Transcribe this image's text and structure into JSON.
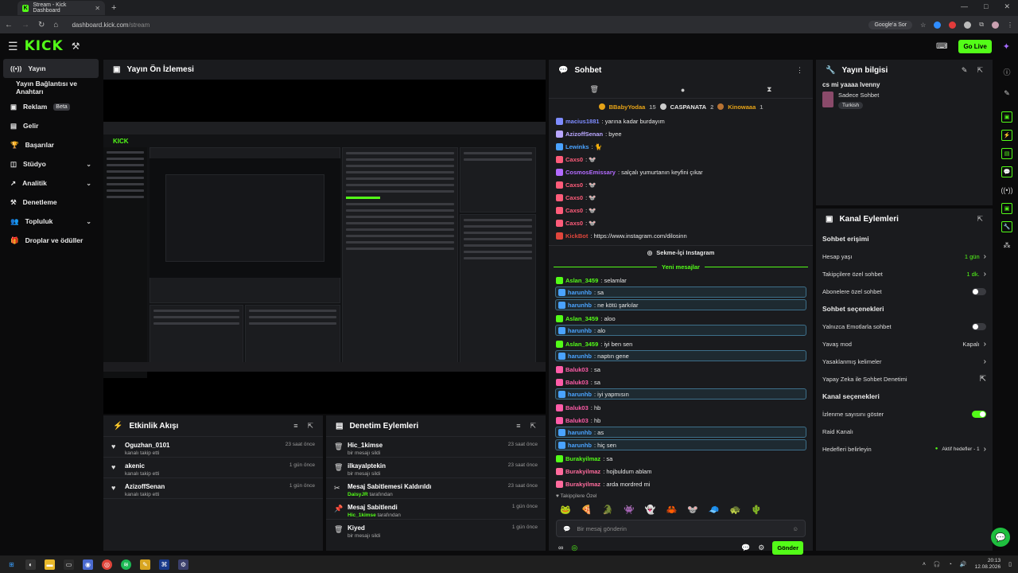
{
  "browser": {
    "tab_title": "Stream - Kick Dashboard",
    "url_host": "dashboard.kick.com",
    "url_path": "/stream",
    "google_sor": "Google'a Sor",
    "window_controls": [
      "—",
      "□",
      "✕"
    ]
  },
  "topnav": {
    "logo": "KICK",
    "golive_label": "Go Live"
  },
  "sidebar": {
    "items": [
      {
        "label": "Yayın",
        "icon": "broadcast-icon"
      },
      {
        "label": "Yayın Bağlantısı ve Anahtarı"
      },
      {
        "label": "Reklam",
        "badge": "Beta",
        "icon": "ads-icon"
      },
      {
        "label": "Gelir",
        "icon": "revenue-icon"
      },
      {
        "label": "Başarılar",
        "icon": "trophy-icon"
      },
      {
        "label": "Stüdyo",
        "icon": "studio-icon"
      },
      {
        "label": "Analitik",
        "icon": "analytics-icon"
      },
      {
        "label": "Denetleme",
        "icon": "moderation-icon"
      },
      {
        "label": "Topluluk",
        "icon": "community-icon"
      },
      {
        "label": "Droplar ve ödüller",
        "icon": "drops-icon"
      }
    ]
  },
  "preview": {
    "title": "Yayın Ön İzlemesi"
  },
  "activity": {
    "title": "Etkinlik Akışı",
    "rows": [
      {
        "name": "Oguzhan_0101",
        "sub": "kanalı takip etti",
        "time": "23 saat önce"
      },
      {
        "name": "akenic",
        "sub": "kanalı takip etti",
        "time": "1 gün önce"
      },
      {
        "name": "AzizoffSenan",
        "sub": "kanalı takip etti",
        "time": "1 gün önce"
      }
    ]
  },
  "modlog": {
    "title": "Denetim Eylemleri",
    "rows": [
      {
        "name": "Hic_1kimse",
        "sub": "bir mesajı sildi",
        "extra": "",
        "time": "23 saat önce"
      },
      {
        "name": "ilkayalptekin",
        "sub": "bir mesajı sildi",
        "extra": "",
        "time": "23 saat önce"
      },
      {
        "name": "Mesaj Sabitlemesi Kaldırıldı",
        "sub": "tarafından",
        "extra": "DaisyJR",
        "time": "23 saat önce"
      },
      {
        "name": "Mesaj Sabitlendi",
        "sub": "tarafından",
        "extra": "Hic_1kimse",
        "time": "1 gün önce"
      },
      {
        "name": "Kiyed",
        "sub": "bir mesajı sildi",
        "extra": "",
        "time": "1 gün önce"
      }
    ]
  },
  "chat": {
    "title": "Sohbet",
    "pinned": [
      {
        "name": "BBabyYodaa",
        "count": "15"
      },
      {
        "name": "CASPANATA",
        "count": "2"
      },
      {
        "name": "Kinowaaa",
        "count": "1"
      }
    ],
    "messages_top": [
      {
        "user": "macius1881",
        "text": ": yarına kadar burdayım",
        "color": "#7e8cff"
      },
      {
        "user": "AzizoffSenan",
        "text": ": byee",
        "color": "#b9a7ff"
      },
      {
        "user": "Lewinks",
        "text": ": 🐈",
        "color": "#4aa3ff"
      },
      {
        "user": "Caxs0",
        "text": ": 🐭",
        "color": "#ff5c7a"
      },
      {
        "user": "CosmosEmissary",
        "text": ": salçalı yumurtanın keyfini çıkar",
        "color": "#b36bff"
      },
      {
        "user": "Caxs0",
        "text": ": 🐭",
        "color": "#ff5c7a"
      },
      {
        "user": "Caxs0",
        "text": ": 🐭",
        "color": "#ff5c7a"
      },
      {
        "user": "Caxs0",
        "text": ": 🐭",
        "color": "#ff5c7a"
      },
      {
        "user": "Caxs0",
        "text": ": 🐭",
        "color": "#ff5c7a"
      },
      {
        "user": "KickBot",
        "text": ": https://www.instagram.com/dilosinn",
        "color": "#e0463c"
      }
    ],
    "instagram_label": "Sekme-İçi Instagram",
    "new_messages": "Yeni mesajlar",
    "messages_bottom": [
      {
        "user": "Aslan_3459",
        "text": ": selamlar",
        "color": "#53fc18",
        "box": false
      },
      {
        "user": "harunhb",
        "text": ": sa",
        "color": "#4aa3ff",
        "box": true
      },
      {
        "user": "harunhb",
        "text": ": ne kötü şarkılar",
        "color": "#4aa3ff",
        "box": true
      },
      {
        "user": "Aslan_3459",
        "text": ": aloo",
        "color": "#53fc18",
        "box": false
      },
      {
        "user": "harunhb",
        "text": ": alo",
        "color": "#4aa3ff",
        "box": true
      },
      {
        "user": "Aslan_3459",
        "text": ": iyi ben sen",
        "color": "#53fc18",
        "box": false
      },
      {
        "user": "harunhb",
        "text": ": naptın gene",
        "color": "#4aa3ff",
        "box": true
      },
      {
        "user": "Baluk03",
        "text": ": sa",
        "color": "#ff5ca8",
        "box": false
      },
      {
        "user": "Baluk03",
        "text": ": sa",
        "color": "#ff5ca8",
        "box": false
      },
      {
        "user": "harunhb",
        "text": ": iyi yapmısın",
        "color": "#4aa3ff",
        "box": true
      },
      {
        "user": "Baluk03",
        "text": ": hb",
        "color": "#ff5ca8",
        "box": false
      },
      {
        "user": "Baluk03",
        "text": ": hb",
        "color": "#ff5ca8",
        "box": false
      },
      {
        "user": "harunhb",
        "text": ": as",
        "color": "#4aa3ff",
        "box": true
      },
      {
        "user": "harunhb",
        "text": ": hiç sen",
        "color": "#4aa3ff",
        "box": true
      },
      {
        "user": "Burakyilmaz",
        "text": ": sa",
        "color": "#53fc18",
        "box": false
      },
      {
        "user": "Burakyilmaz",
        "text": ": hojbuldum ablam",
        "color": "#ff6b9d",
        "box": false
      },
      {
        "user": "Burakyilmaz",
        "text": ": arda mordred mi",
        "color": "#ff6b9d",
        "box": false
      }
    ],
    "followers_only": "Takipçilere Özel",
    "emotes": [
      "🐸",
      "🍕",
      "🐊",
      "👾",
      "👻",
      "🦀",
      "🐭",
      "🧢",
      "🐢",
      "🌵"
    ],
    "input_placeholder": "Bir mesaj gönderin",
    "send_label": "Gönder"
  },
  "stream_info": {
    "title": "Yayın bilgisi",
    "stream_title": "cs mi yaaaa lvenny",
    "category": "Sadece Sohbet",
    "tag": "Turkish"
  },
  "channel_actions": {
    "title": "Kanal Eylemleri",
    "sections": [
      {
        "heading": "Sohbet erişimi",
        "rows": [
          {
            "label": "Hesap yaşı",
            "value": "1 gün",
            "type": "link-green"
          },
          {
            "label": "Takipçilere özel sohbet",
            "value": "1 dk.",
            "type": "link-green"
          },
          {
            "label": "Abonelere özel sohbet",
            "value": "",
            "type": "toggle-off"
          }
        ]
      },
      {
        "heading": "Sohbet seçenekleri",
        "rows": [
          {
            "label": "Yalnızca Emotlarla sohbet",
            "value": "",
            "type": "toggle-off"
          },
          {
            "label": "Yavaş mod",
            "value": "Kapalı",
            "type": "link"
          },
          {
            "label": "Yasaklanmış kelimeler",
            "value": "",
            "type": "link"
          },
          {
            "label": "Yapay Zeka ile Sohbet Denetimi",
            "value": "",
            "type": "external"
          }
        ]
      },
      {
        "heading": "Kanal seçenekleri",
        "rows": [
          {
            "label": "İzlenme sayısını göster",
            "value": "",
            "type": "toggle-on"
          },
          {
            "label": "Raid Kanalı",
            "value": "",
            "type": "none"
          },
          {
            "label": "Hedefleri belirleyin",
            "value": "Aktif hedefler - 1",
            "type": "link-dot"
          }
        ]
      }
    ]
  },
  "taskbar": {
    "time": "20:13",
    "date": "12.08.2026"
  }
}
